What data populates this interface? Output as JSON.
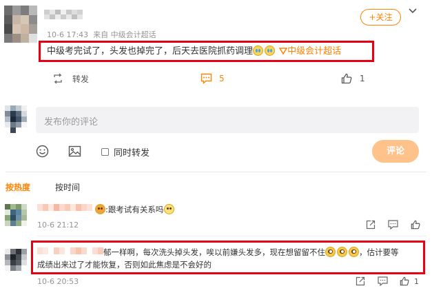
{
  "post": {
    "username": "",
    "meta": "10-6 17:43  来自 中级会计超话",
    "follow_label": "+关注",
    "text": "中级考完试了，头发也掉完了，后天去医院抓药调理",
    "topic_label": "中级会计超话",
    "repost_label": "转发",
    "comment_count": "5",
    "like_count": "1"
  },
  "composer": {
    "placeholder": "发布你的评论",
    "repost_checkbox_label": "同时转发",
    "submit_label": "评论"
  },
  "sort_tabs": [
    {
      "label": "按热度"
    },
    {
      "label": "按时间"
    }
  ],
  "comments": [
    {
      "text": ":跟考试有关系吗",
      "time": "10-6 21:12",
      "like_count": ""
    },
    {
      "text_line1": "郁一样啊，每次洗头掉头发，唉以前嫌头发多，现在想留留不住",
      "text_line1_tail": "，估计要等",
      "text_line2": "成绩出来过了才能恢复，否则如此焦虑是不会好的",
      "time": "10-6 20:53",
      "like_count": "1"
    }
  ],
  "colors": {
    "accent_orange": "#ff8200",
    "highlight_red": "#e60012",
    "input_bg": "#f2f2f5",
    "submit_bg": "#ffc28a"
  }
}
